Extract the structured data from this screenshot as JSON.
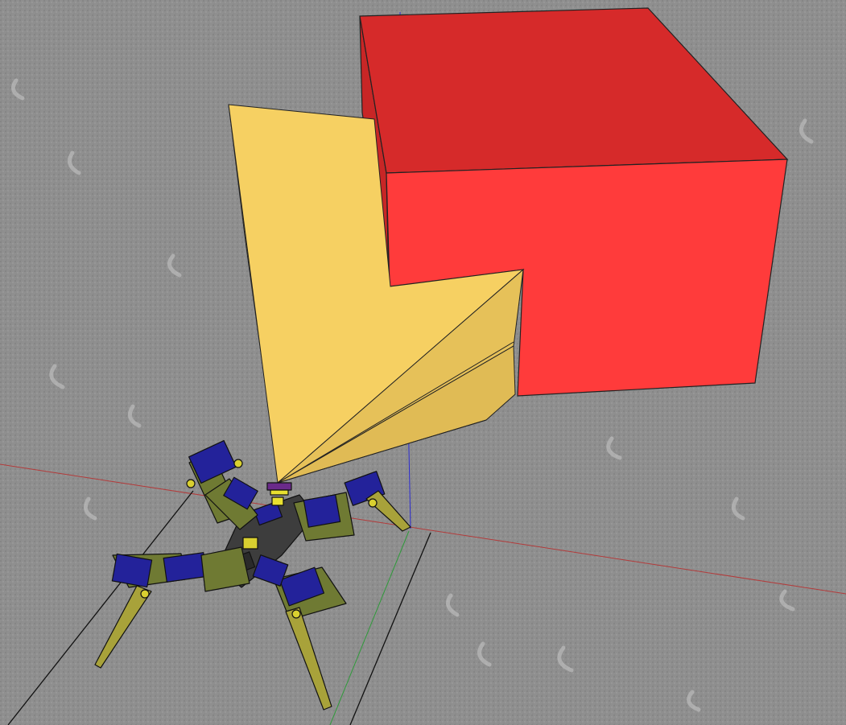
{
  "scene": {
    "ground_texture": "gray-carpet-texture",
    "objects": [
      {
        "name": "red-box",
        "type": "box"
      },
      {
        "name": "yellow-sensor-cone",
        "type": "sensor-field"
      },
      {
        "name": "quadruped-robot",
        "type": "robot",
        "legs": 4
      }
    ],
    "axes": [
      "red-axis",
      "green-axis",
      "blue-axis"
    ]
  },
  "colors": {
    "ground": "#8f8f8f",
    "box_top": "#d62a2a",
    "box_front": "#ff3b3b",
    "box_side": "#e82f2f",
    "cone_front": "#f6d060",
    "cone_side": "#e0bb55",
    "servo_blue": "#23229a",
    "bracket_green": "#6f7a33",
    "leg_yellow": "#a8a23a",
    "axis_red": "#b33a3a",
    "axis_green": "#2f9a3a",
    "axis_blue": "#2a2ad0"
  }
}
